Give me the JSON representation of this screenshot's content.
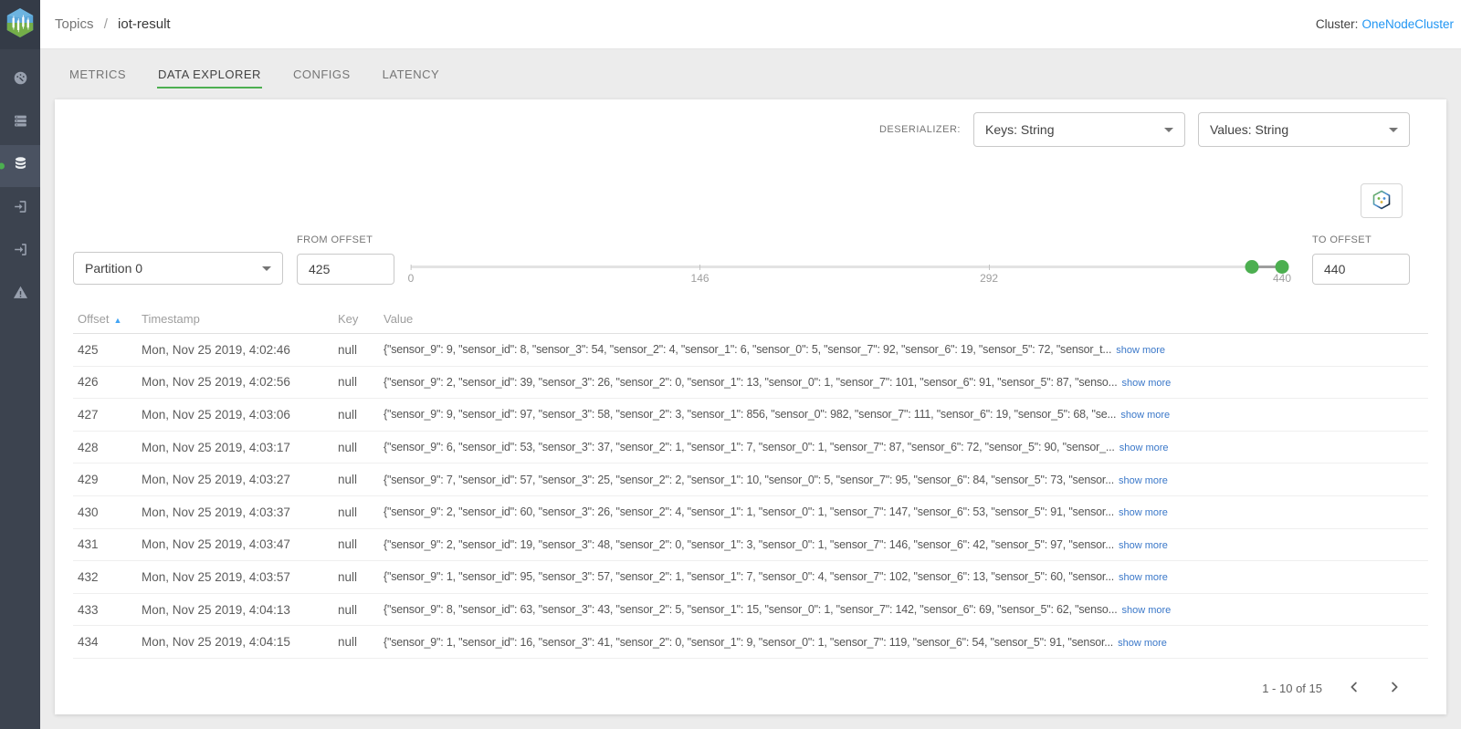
{
  "header": {
    "breadcrumb": {
      "section": "Topics",
      "separator": "/",
      "current": "iot-result"
    },
    "cluster_label": "Cluster:",
    "cluster_name": "OneNodeCluster"
  },
  "sidebar": {
    "icons": [
      "dashboard-gauge-icon",
      "brokers-list-icon",
      "topics-database-icon",
      "consumers-exit-icon",
      "connect-enter-icon",
      "alerts-warning-icon"
    ],
    "active_icon": "topics-database-icon"
  },
  "tabs": [
    {
      "label": "METRICS",
      "active": false
    },
    {
      "label": "DATA EXPLORER",
      "active": true
    },
    {
      "label": "CONFIGS",
      "active": false
    },
    {
      "label": "LATENCY",
      "active": false
    }
  ],
  "controls": {
    "deserializer_label": "DESERIALIZER:",
    "keys_select_value": "Keys: String",
    "values_select_value": "Values: String",
    "partition_select_value": "Partition 0",
    "from_offset_label": "FROM OFFSET",
    "from_offset_value": "425",
    "to_offset_label": "TO OFFSET",
    "to_offset_value": "440",
    "slider": {
      "min": 0,
      "max": 440,
      "handle_from": 425,
      "handle_to": 440,
      "ticks": [
        {
          "value": 0,
          "label": "0"
        },
        {
          "value": 146,
          "label": "146"
        },
        {
          "value": 292,
          "label": "292"
        },
        {
          "value": 440,
          "label": "440"
        }
      ]
    }
  },
  "table": {
    "columns": [
      "Offset",
      "Timestamp",
      "Key",
      "Value"
    ],
    "sort_icon": "ascending-arrow",
    "show_more_label": "show more",
    "rows": [
      {
        "offset": "425",
        "timestamp": "Mon, Nov 25 2019, 4:02:46",
        "key": "null",
        "value": "{\"sensor_9\": 9, \"sensor_id\": 8, \"sensor_3\": 54, \"sensor_2\": 4, \"sensor_1\": 6, \"sensor_0\": 5, \"sensor_7\": 92, \"sensor_6\": 19, \"sensor_5\": 72, \"sensor_t..."
      },
      {
        "offset": "426",
        "timestamp": "Mon, Nov 25 2019, 4:02:56",
        "key": "null",
        "value": "{\"sensor_9\": 2, \"sensor_id\": 39, \"sensor_3\": 26, \"sensor_2\": 0, \"sensor_1\": 13, \"sensor_0\": 1, \"sensor_7\": 101, \"sensor_6\": 91, \"sensor_5\": 87, \"senso..."
      },
      {
        "offset": "427",
        "timestamp": "Mon, Nov 25 2019, 4:03:06",
        "key": "null",
        "value": "{\"sensor_9\": 9, \"sensor_id\": 97, \"sensor_3\": 58, \"sensor_2\": 3, \"sensor_1\": 856, \"sensor_0\": 982, \"sensor_7\": 111, \"sensor_6\": 19, \"sensor_5\": 68, \"se..."
      },
      {
        "offset": "428",
        "timestamp": "Mon, Nov 25 2019, 4:03:17",
        "key": "null",
        "value": "{\"sensor_9\": 6, \"sensor_id\": 53, \"sensor_3\": 37, \"sensor_2\": 1, \"sensor_1\": 7, \"sensor_0\": 1, \"sensor_7\": 87, \"sensor_6\": 72, \"sensor_5\": 90, \"sensor_..."
      },
      {
        "offset": "429",
        "timestamp": "Mon, Nov 25 2019, 4:03:27",
        "key": "null",
        "value": "{\"sensor_9\": 7, \"sensor_id\": 57, \"sensor_3\": 25, \"sensor_2\": 2, \"sensor_1\": 10, \"sensor_0\": 5, \"sensor_7\": 95, \"sensor_6\": 84, \"sensor_5\": 73, \"sensor..."
      },
      {
        "offset": "430",
        "timestamp": "Mon, Nov 25 2019, 4:03:37",
        "key": "null",
        "value": "{\"sensor_9\": 2, \"sensor_id\": 60, \"sensor_3\": 26, \"sensor_2\": 4, \"sensor_1\": 1, \"sensor_0\": 1, \"sensor_7\": 147, \"sensor_6\": 53, \"sensor_5\": 91, \"sensor..."
      },
      {
        "offset": "431",
        "timestamp": "Mon, Nov 25 2019, 4:03:47",
        "key": "null",
        "value": "{\"sensor_9\": 2, \"sensor_id\": 19, \"sensor_3\": 48, \"sensor_2\": 0, \"sensor_1\": 3, \"sensor_0\": 1, \"sensor_7\": 146, \"sensor_6\": 42, \"sensor_5\": 97, \"sensor..."
      },
      {
        "offset": "432",
        "timestamp": "Mon, Nov 25 2019, 4:03:57",
        "key": "null",
        "value": "{\"sensor_9\": 1, \"sensor_id\": 95, \"sensor_3\": 57, \"sensor_2\": 1, \"sensor_1\": 7, \"sensor_0\": 4, \"sensor_7\": 102, \"sensor_6\": 13, \"sensor_5\": 60, \"sensor..."
      },
      {
        "offset": "433",
        "timestamp": "Mon, Nov 25 2019, 4:04:13",
        "key": "null",
        "value": "{\"sensor_9\": 8, \"sensor_id\": 63, \"sensor_3\": 43, \"sensor_2\": 5, \"sensor_1\": 15, \"sensor_0\": 1, \"sensor_7\": 142, \"sensor_6\": 69, \"sensor_5\": 62, \"senso..."
      },
      {
        "offset": "434",
        "timestamp": "Mon, Nov 25 2019, 4:04:15",
        "key": "null",
        "value": "{\"sensor_9\": 1, \"sensor_id\": 16, \"sensor_3\": 41, \"sensor_2\": 0, \"sensor_1\": 9, \"sensor_0\": 1, \"sensor_7\": 119, \"sensor_6\": 54, \"sensor_5\": 91, \"sensor..."
      }
    ]
  },
  "pagination": {
    "range_text": "1 - 10 of 15"
  },
  "colors": {
    "accent_green": "#4caf50",
    "link_blue": "#2196f3",
    "sidebar_bg": "#3c434f",
    "sort_arrow_blue": "#42a5f5"
  }
}
